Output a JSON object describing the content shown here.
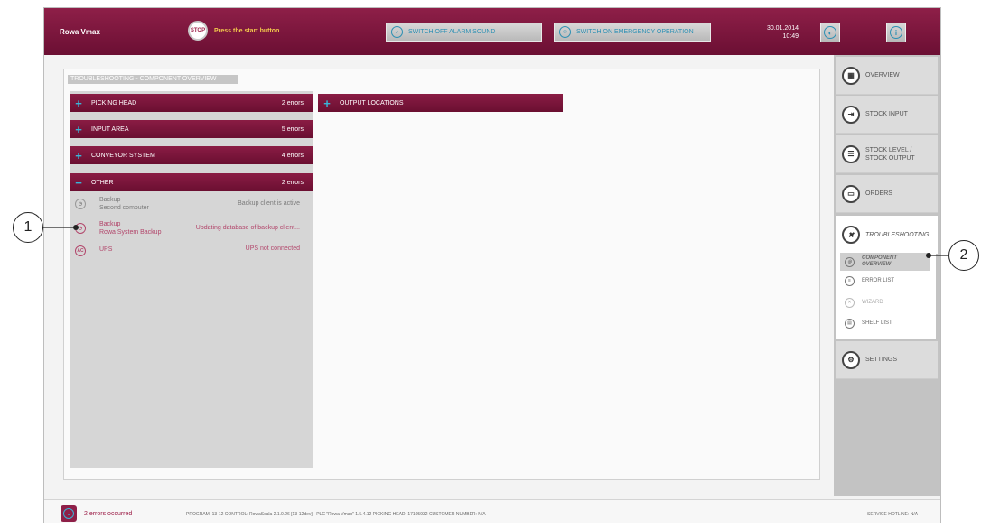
{
  "header": {
    "app_name": "Rowa Vmax",
    "stop_label": "STOP",
    "start_prompt": "Press the start button",
    "alarm_button": "SWITCH OFF ALARM SOUND",
    "emergency_button": "SWITCH ON EMERGENCY OPERATION",
    "date": "30.01.2014",
    "time": "10:49"
  },
  "section": {
    "title": "TROUBLESHOOTING - COMPONENT OVERVIEW"
  },
  "groups": [
    {
      "sign": "+",
      "label": "PICKING HEAD",
      "count": "2 errors"
    },
    {
      "sign": "+",
      "label": "INPUT AREA",
      "count": "5 errors"
    },
    {
      "sign": "+",
      "label": "CONVEYOR SYSTEM",
      "count": "4 errors"
    },
    {
      "sign": "−",
      "label": "OTHER",
      "count": "2 errors"
    }
  ],
  "output_group": {
    "sign": "+",
    "label": "OUTPUT LOCATIONS"
  },
  "other_items": [
    {
      "name": "Backup",
      "sub": "Second computer",
      "status": "Backup client is active"
    },
    {
      "name": "Backup",
      "sub": "Rowa System Backup",
      "status": "Updating database of backup client..."
    },
    {
      "name": "UPS",
      "icon_text": "AC",
      "status": "UPS not connected"
    }
  ],
  "menu": {
    "overview": "OVERVIEW",
    "stock_input": "STOCK INPUT",
    "stock_level": "STOCK LEVEL / STOCK OUTPUT",
    "orders": "ORDERS",
    "troubleshooting": "TROUBLESHOOTING",
    "sub": {
      "component_overview": "COMPONENT OVERVIEW",
      "error_list": "ERROR LIST",
      "wizard": "WIZARD",
      "shelf_list": "SHELF LIST"
    },
    "settings": "SETTINGS"
  },
  "status_bar": {
    "errors": "2 errors occurred",
    "program_info": "PROGRAM: 13-12   CONTROL: RowaScala 2.1.0.26 [13-12dev] - PLC \"Rowa Vmax\" 1.5.4.12   PICKING HEAD: 17105932   CUSTOMER NUMBER: N/A",
    "hotline": "SERVICE HOTLINE: N/A"
  },
  "callouts": [
    "1",
    "2"
  ],
  "colors": {
    "brand": "#7a1538",
    "accent": "#2a8fb3",
    "error_text": "#b2466b"
  }
}
